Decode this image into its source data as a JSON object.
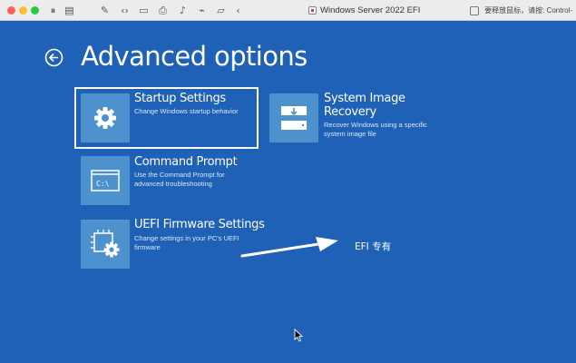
{
  "window": {
    "title": "Windows Server 2022 EFI",
    "hint": "要释放鼠标，请按: Control-"
  },
  "page": {
    "title": "Advanced options"
  },
  "options": [
    {
      "title": "Startup Settings",
      "description": "Change Windows startup behavior",
      "icon": "gear-icon",
      "selected": true
    },
    {
      "title": "System Image Recovery",
      "title_lines": [
        "System Image",
        "Recovery"
      ],
      "description_lines": [
        "Recover Windows using a specific",
        "system image file"
      ],
      "icon": "system-image-icon"
    },
    {
      "title": "Command Prompt",
      "description_lines": [
        "Use the Command Prompt for",
        "advanced troubleshooting"
      ],
      "icon": "command-prompt-icon",
      "tile_text": "C:\\"
    },
    {
      "title": "UEFI Firmware Settings",
      "description_lines": [
        "Change settings in your PC's UEFI",
        "firmware"
      ],
      "icon": "uefi-firmware-icon"
    }
  ],
  "annotation": {
    "text": "EFI 专有"
  },
  "colors": {
    "background": "#1f61b6",
    "tile": "#4d91cd",
    "text": "#ffffff"
  }
}
